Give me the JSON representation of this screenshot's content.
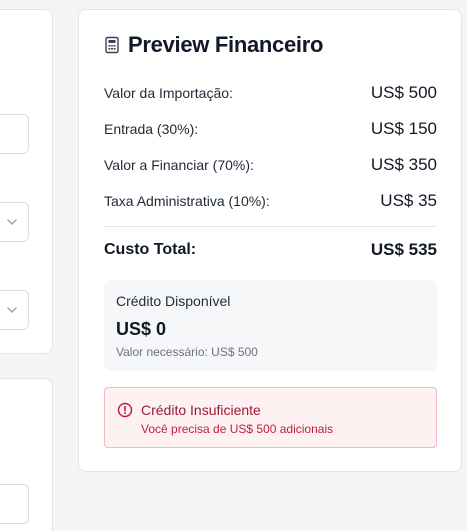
{
  "preview": {
    "title": "Preview Financeiro",
    "rows": [
      {
        "label": "Valor da Importação:",
        "value": "US$ 500"
      },
      {
        "label": "Entrada (30%):",
        "value": "US$ 150"
      },
      {
        "label": "Valor a Financiar (70%):",
        "value": "US$ 350"
      },
      {
        "label": "Taxa Administrativa (10%):",
        "value": "US$ 35"
      }
    ],
    "total": {
      "label": "Custo Total:",
      "value": "US$ 535"
    },
    "credit": {
      "label": "Crédito Disponível",
      "value": "US$ 0",
      "note": "Valor necessário: US$ 500"
    },
    "alert": {
      "title": "Crédito Insuficiente",
      "message": "Você precisa de US$ 500 adicionais"
    }
  },
  "icons": {
    "title_icon": "calculator-icon",
    "alert_icon": "alert-circle-icon",
    "select_icon": "chevron-down-icon"
  },
  "colors": {
    "alert_background": "#fdf1f2",
    "alert_border": "#f5b8bf",
    "alert_title": "#9b1c31",
    "alert_text": "#c0223c"
  }
}
